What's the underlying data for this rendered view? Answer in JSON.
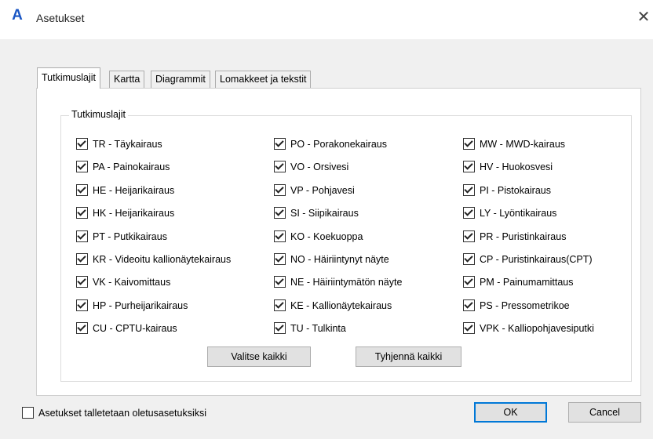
{
  "window": {
    "title": "Asetukset"
  },
  "tabs": [
    {
      "label": "Tutkimuslajit",
      "active": true
    },
    {
      "label": "Kartta",
      "active": false
    },
    {
      "label": "Diagrammit",
      "active": false
    },
    {
      "label": "Lomakkeet ja tekstit",
      "active": false
    }
  ],
  "group": {
    "title": "Tutkimuslajit",
    "columns": [
      [
        {
          "label": "TR - Täykairaus",
          "checked": true
        },
        {
          "label": "PA - Painokairaus",
          "checked": true
        },
        {
          "label": "HE - Heijarikairaus",
          "checked": true
        },
        {
          "label": "HK - Heijarikairaus",
          "checked": true
        },
        {
          "label": "PT - Putkikairaus",
          "checked": true
        },
        {
          "label": "KR - Videoitu kallionäytekairaus",
          "checked": true
        },
        {
          "label": "VK - Kaivomittaus",
          "checked": true
        },
        {
          "label": "HP - Purheijarikairaus",
          "checked": true
        },
        {
          "label": "CU - CPTU-kairaus",
          "checked": true
        }
      ],
      [
        {
          "label": "PO - Porakonekairaus",
          "checked": true
        },
        {
          "label": "VO - Orsivesi",
          "checked": true
        },
        {
          "label": "VP - Pohjavesi",
          "checked": true
        },
        {
          "label": "SI - Siipikairaus",
          "checked": true
        },
        {
          "label": "KO - Koekuoppa",
          "checked": true
        },
        {
          "label": "NO - Häiriintynyt näyte",
          "checked": true
        },
        {
          "label": "NE - Häiriintymätön näyte",
          "checked": true
        },
        {
          "label": "KE - Kallionäytekairaus",
          "checked": true
        },
        {
          "label": "TU - Tulkinta",
          "checked": true
        }
      ],
      [
        {
          "label": "MW - MWD-kairaus",
          "checked": true
        },
        {
          "label": "HV - Huokosvesi",
          "checked": true
        },
        {
          "label": "PI - Pistokairaus",
          "checked": true
        },
        {
          "label": "LY - Lyöntikairaus",
          "checked": true
        },
        {
          "label": "PR - Puristinkairaus",
          "checked": true
        },
        {
          "label": "CP - Puristinkairaus(CPT)",
          "checked": true
        },
        {
          "label": "PM - Painumamittaus",
          "checked": true
        },
        {
          "label": "PS - Pressometrikoe",
          "checked": true
        },
        {
          "label": "VPK - Kalliopohjavesiputki",
          "checked": true
        }
      ]
    ],
    "select_all_label": "Valitse kaikki",
    "clear_all_label": "Tyhjennä kaikki"
  },
  "footer": {
    "save_default_label": "Asetukset talletetaan oletusasetuksiksi",
    "save_default_checked": false,
    "ok_label": "OK",
    "cancel_label": "Cancel"
  },
  "icons": {
    "app": "autocad-a-icon",
    "close": "close-icon",
    "check": "check-icon"
  },
  "colors": {
    "accent": "#0078d7",
    "app_icon": "#1a56c4"
  }
}
